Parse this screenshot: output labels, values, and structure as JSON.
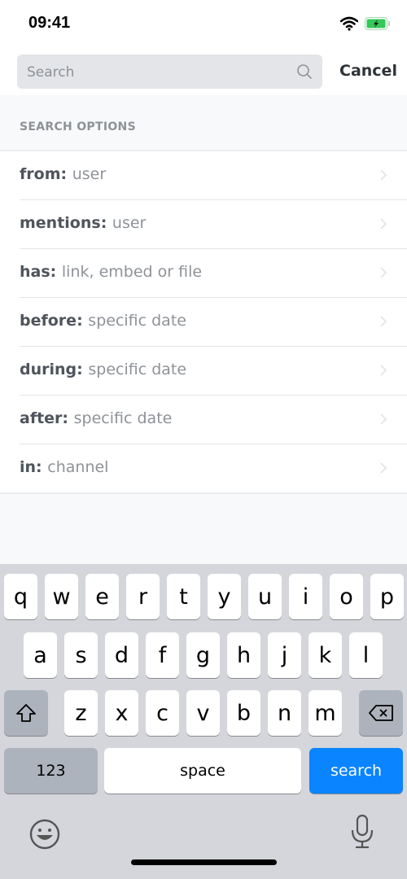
{
  "status_bar": {
    "time": "09:41",
    "icons": [
      "wifi-icon",
      "battery-charging-icon"
    ],
    "battery_color": "#34c759"
  },
  "search": {
    "placeholder": "Search",
    "value": "",
    "cancel_label": "Cancel"
  },
  "section_header": "SEARCH OPTIONS",
  "options": [
    {
      "key": "from:",
      "value": "user"
    },
    {
      "key": "mentions:",
      "value": "user"
    },
    {
      "key": "has:",
      "value": "link, embed or file"
    },
    {
      "key": "before:",
      "value": "specific date"
    },
    {
      "key": "during:",
      "value": "specific date"
    },
    {
      "key": "after:",
      "value": "specific date"
    },
    {
      "key": "in:",
      "value": "channel"
    }
  ],
  "keyboard": {
    "row1": [
      "q",
      "w",
      "e",
      "r",
      "t",
      "y",
      "u",
      "i",
      "o",
      "p"
    ],
    "row2": [
      "a",
      "s",
      "d",
      "f",
      "g",
      "h",
      "j",
      "k",
      "l"
    ],
    "row3": [
      "z",
      "x",
      "c",
      "v",
      "b",
      "n",
      "m"
    ],
    "numbers_label": "123",
    "space_label": "space",
    "return_label": "search",
    "return_color": "#0a84ff"
  }
}
